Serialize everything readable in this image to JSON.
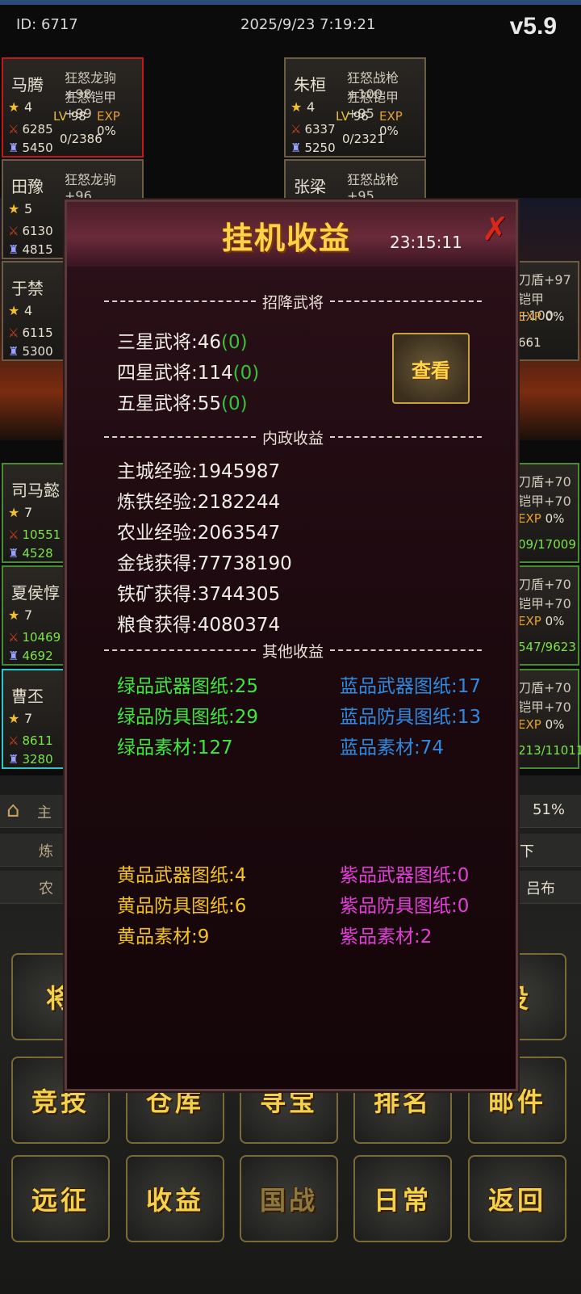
{
  "status": {
    "id": "ID:  6717",
    "datetime": "2025/9/23 7:19:21",
    "version": "v5.9"
  },
  "cards": [
    {
      "name": "马腾",
      "eq1": "狂怒龙驹+98",
      "eq2": "狂怒铠甲+99",
      "stars": "4",
      "lv": "98",
      "exp": "0%",
      "atk": "6285",
      "def": "5450",
      "hp": "0/2386"
    },
    {
      "name": "朱桓",
      "eq1": "狂怒战枪+100",
      "eq2": "狂怒铠甲+95",
      "stars": "4",
      "lv": "96",
      "exp": "0%",
      "atk": "6337",
      "def": "5250",
      "hp": "0/2321"
    },
    {
      "name": "田豫",
      "eq1": "狂怒龙驹+96",
      "stars": "5",
      "atk": "6130",
      "def": "4815"
    },
    {
      "name": "张梁",
      "eq1": "狂怒战枪+95"
    },
    {
      "name": "于禁",
      "stars": "4",
      "atk": "6115",
      "def": "5300"
    },
    {
      "name": "司马懿",
      "stars": "7",
      "atk": "10551",
      "def": "4528"
    },
    {
      "name": "夏侯惇",
      "stars": "7",
      "atk": "10469",
      "def": "4692"
    },
    {
      "name": "曹丕",
      "stars": "7",
      "atk": "8611",
      "def": "3280"
    }
  ],
  "right_partial": {
    "r1a": "刀盾+97",
    "r1b": "铠甲+100",
    "r1exp": "EXP",
    "r1expv": "0%",
    "r1hp": "661",
    "r2a": "刀盾+70",
    "r2b": "铠甲+70",
    "r2exp": "EXP",
    "r2expv": "0%",
    "r2hp": "09/17009",
    "r3a": "刀盾+70",
    "r3b": "铠甲+70",
    "r3exp": "EXP",
    "r3expv": "0%",
    "r3hp": "547/9623",
    "r4a": "刀盾+70",
    "r4b": "铠甲+70",
    "r4exp": "EXP",
    "r4expv": "0%",
    "r4hp": "213/11011"
  },
  "bars": {
    "percent": "51%",
    "b2": "下",
    "b3": "吕布",
    "l1": "主",
    "l2": "炼",
    "l3": "农"
  },
  "labels": {
    "lv": "LV",
    "exp": "EXP"
  },
  "buttons": {
    "r1a": "将",
    "r1b": "役",
    "r2": [
      "竞技",
      "仓库",
      "寻宝",
      "排名",
      "邮件"
    ],
    "r3": [
      "远征",
      "收益",
      "国战",
      "日常",
      "返回"
    ]
  },
  "modal": {
    "title": "挂机收益",
    "time": "23:15:11",
    "close": "✗",
    "section1": "招降武将",
    "section2": "内政收益",
    "section3": "其他收益",
    "view_button": "查看",
    "recruit": [
      {
        "label": "三星武将:46",
        "extra": "(0)"
      },
      {
        "label": "四星武将:114",
        "extra": "(0)"
      },
      {
        "label": "五星武将:55",
        "extra": "(0)"
      }
    ],
    "domestic": [
      "主城经验:1945987",
      "炼铁经验:2182244",
      "农业经验:2063547",
      "金钱获得:77738190",
      "铁矿获得:3744305",
      "粮食获得:4080374"
    ],
    "green": [
      "绿品武器图纸:25",
      "绿品防具图纸:29",
      "绿品素材:127"
    ],
    "blue": [
      "蓝品武器图纸:17",
      "蓝品防具图纸:13",
      "蓝品素材:74"
    ],
    "yellow": [
      "黄品武器图纸:4",
      "黄品防具图纸:6",
      "黄品素材:9"
    ],
    "purple": [
      "紫品武器图纸:0",
      "紫品防具图纸:0",
      "紫品素材:2"
    ]
  }
}
